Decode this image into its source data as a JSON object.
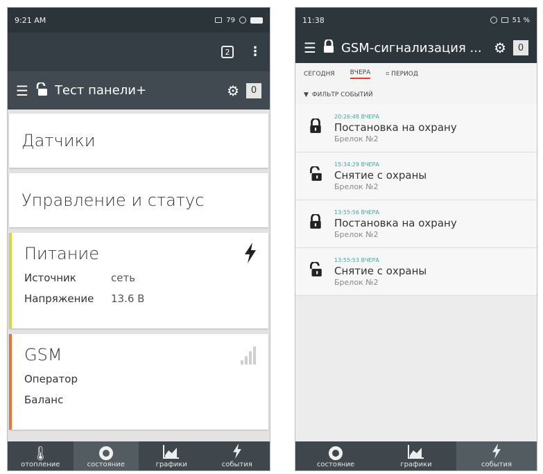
{
  "left": {
    "status_bar": {
      "time": "9:21 AM",
      "extra": "79"
    },
    "subbar": {
      "tabs_count": "2",
      "menu": "⋮"
    },
    "toolbar": {
      "title": "Тест панели+",
      "badge": "0"
    },
    "cards": {
      "sensors": "Датчики",
      "control": "Управление и статус",
      "power": {
        "title": "Питание",
        "rows": [
          {
            "key": "Источник",
            "value": "сеть"
          },
          {
            "key": "Напряжение",
            "value": "13.6 В"
          }
        ],
        "accent": "#cdd94a"
      },
      "gsm": {
        "title": "GSM",
        "rows": [
          {
            "key": "Оператор",
            "value": ""
          },
          {
            "key": "Баланс",
            "value": ""
          }
        ],
        "accent": "#e07a3a"
      }
    },
    "bottom_nav": [
      {
        "label": "отопление",
        "icon": "thermometer-icon"
      },
      {
        "label": "состояние",
        "icon": "ring-icon",
        "active": true
      },
      {
        "label": "графики",
        "icon": "chart-icon"
      },
      {
        "label": "события",
        "icon": "lightning-icon"
      }
    ]
  },
  "right": {
    "status_bar": {
      "time": "11:38",
      "battery": "51 %"
    },
    "toolbar": {
      "title": "GSM-сигнализация ...",
      "badge": "0"
    },
    "tabs": [
      "СЕГОДНЯ",
      "ВЧЕРА",
      "ПЕРИОД"
    ],
    "active_tab": "ВЧЕРА",
    "filter_label": "ФИЛЬТР СОБЫТИЙ",
    "events": [
      {
        "time": "20:26:48 ВЧЕРА",
        "title": "Постановка на охрану",
        "source": "Брелок №2",
        "icon": "locked-icon"
      },
      {
        "time": "15:34:29 ВЧЕРА",
        "title": "Снятие с охраны",
        "source": "Брелок №2",
        "icon": "unlocked-icon"
      },
      {
        "time": "13:55:56 ВЧЕРА",
        "title": "Постановка на охрану",
        "source": "Брелок №2",
        "icon": "locked-icon"
      },
      {
        "time": "13:55:53 ВЧЕРА",
        "title": "Снятие с охраны",
        "source": "Брелок №2",
        "icon": "unlocked-icon"
      }
    ],
    "bottom_nav": [
      {
        "label": "состояние",
        "icon": "ring-icon"
      },
      {
        "label": "графики",
        "icon": "chart-icon"
      },
      {
        "label": "события",
        "icon": "lightning-icon",
        "active": true
      }
    ]
  }
}
